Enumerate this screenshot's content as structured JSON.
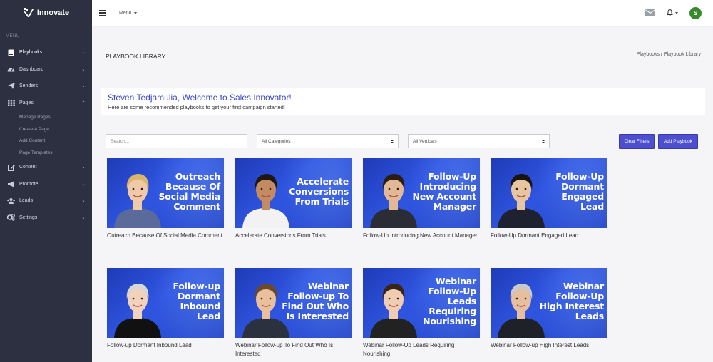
{
  "brand": {
    "name": "Innovate"
  },
  "sidebar": {
    "heading": "MENU",
    "items": [
      {
        "label": "Playbooks",
        "icon": "book-icon",
        "active": true
      },
      {
        "label": "Dashboard",
        "icon": "dashboard-icon"
      },
      {
        "label": "Senders",
        "icon": "paper-plane-icon"
      },
      {
        "label": "Pages",
        "icon": "grid-icon",
        "expanded": true
      },
      {
        "label": "Content",
        "icon": "edit-icon"
      },
      {
        "label": "Promote",
        "icon": "megaphone-icon"
      },
      {
        "label": "Leads",
        "icon": "users-icon"
      },
      {
        "label": "Settings",
        "icon": "gears-icon"
      }
    ],
    "sub_items": [
      "Manage Pages",
      "Create A Page",
      "Add Content",
      "Page Templates"
    ]
  },
  "topbar": {
    "menu_label": "Menu",
    "avatar_initial": "S"
  },
  "page": {
    "title": "PLAYBOOK LIBRARY",
    "breadcrumb": "Playbooks / Playbook Library"
  },
  "welcome": {
    "heading": "Steven Tedjamulia, Welcome to Sales Innovator!",
    "subtext": "Here are some recommended playbooks to get your first campaign started!"
  },
  "filters": {
    "search_placeholder": "Search...",
    "category_selected": "All Categories",
    "vertical_selected": "All Verticals",
    "clear_label": "Clear Filters",
    "add_label": "Add Playbook"
  },
  "playbooks": [
    {
      "thumb_text": "Outreach\nBecause Of\nSocial Media\nComment",
      "caption": "Outreach Because Of Social Media Comment",
      "person": "woman-blonde"
    },
    {
      "thumb_text": "Accelerate\nConversions\nFrom Trials",
      "caption": "Accelerate Conversions From Trials",
      "person": "woman-curly"
    },
    {
      "thumb_text": "Follow-Up\nIntroducing\nNew Account\nManager",
      "caption": "Follow-Up Introducing New Account Manager",
      "person": "man-suit"
    },
    {
      "thumb_text": "Follow-Up\nDormant\nEngaged\nLead",
      "caption": "Follow-Up Dormant Engaged Lead",
      "person": "man-young"
    },
    {
      "thumb_text": "Follow-up\nDormant\nInbound\nLead",
      "caption": "Follow-up Dormant Inbound Lead",
      "person": "woman-gray"
    },
    {
      "thumb_text": "Webinar\nFollow-up To\nFind Out Who\nIs Interested",
      "caption": "Webinar Follow-up To Find Out Who Is Interested",
      "person": "man-smile"
    },
    {
      "thumb_text": "Webinar\nFollow-Up\nLeads\nRequiring\nNourishing",
      "caption": "Webinar Follow-Up Leads Requiring Nourishing",
      "person": "woman-dark"
    },
    {
      "thumb_text": "Webinar\nFollow-Up\nHigh Interest\nLeads",
      "caption": "Webinar Follow-up High Interest Leads",
      "person": "man-gray"
    }
  ]
}
